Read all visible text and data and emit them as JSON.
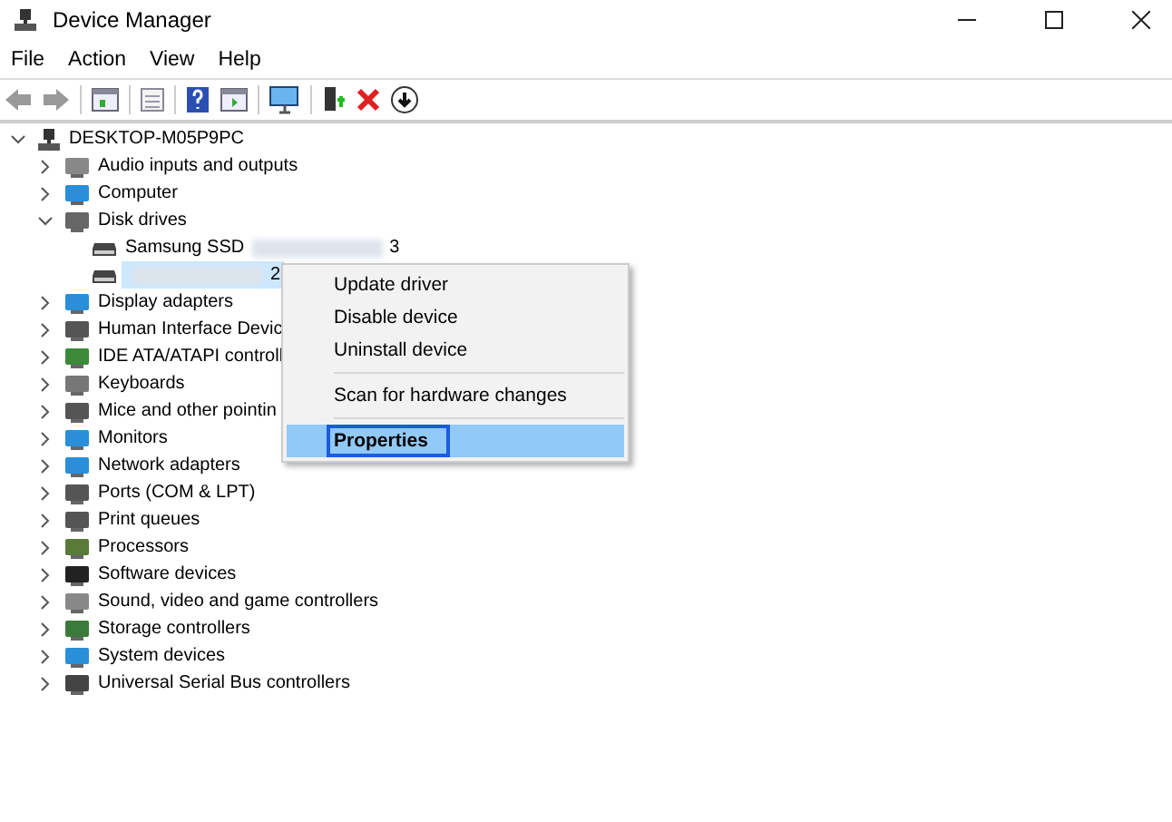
{
  "window": {
    "title": "Device Manager"
  },
  "menu_bar": [
    "File",
    "Action",
    "View",
    "Help"
  ],
  "tree": {
    "label": "DESKTOP-M05P9PC",
    "expanded": true,
    "children": [
      {
        "label": "Audio inputs and outputs",
        "expanded": false
      },
      {
        "label": "Computer",
        "expanded": false
      },
      {
        "label": "Disk drives",
        "expanded": true,
        "children": [
          {
            "label": "Samsung SSD",
            "suffix": "3",
            "selected": false
          },
          {
            "suffix": "2",
            "selected": true
          }
        ]
      },
      {
        "label": "Display adapters",
        "expanded": false
      },
      {
        "label": "Human Interface Devic",
        "expanded": false
      },
      {
        "label": "IDE ATA/ATAPI controll",
        "expanded": false
      },
      {
        "label": "Keyboards",
        "expanded": false
      },
      {
        "label": "Mice and other pointin",
        "expanded": false
      },
      {
        "label": "Monitors",
        "expanded": false
      },
      {
        "label": "Network adapters",
        "expanded": false
      },
      {
        "label": "Ports (COM & LPT)",
        "expanded": false
      },
      {
        "label": "Print queues",
        "expanded": false
      },
      {
        "label": "Processors",
        "expanded": false
      },
      {
        "label": "Software devices",
        "expanded": false
      },
      {
        "label": "Sound, video and game controllers",
        "expanded": false
      },
      {
        "label": "Storage controllers",
        "expanded": false
      },
      {
        "label": "System devices",
        "expanded": false
      },
      {
        "label": "Universal Serial Bus controllers",
        "expanded": false
      }
    ]
  },
  "context_menu": [
    {
      "kind": "item",
      "label": "Update driver",
      "selected": false
    },
    {
      "kind": "item",
      "label": "Disable device",
      "selected": false
    },
    {
      "kind": "item",
      "label": "Uninstall device",
      "selected": false
    },
    {
      "kind": "separator"
    },
    {
      "kind": "item",
      "label": "Scan for hardware changes",
      "selected": false
    },
    {
      "kind": "separator"
    },
    {
      "kind": "item",
      "label": "Properties",
      "selected": true
    }
  ]
}
